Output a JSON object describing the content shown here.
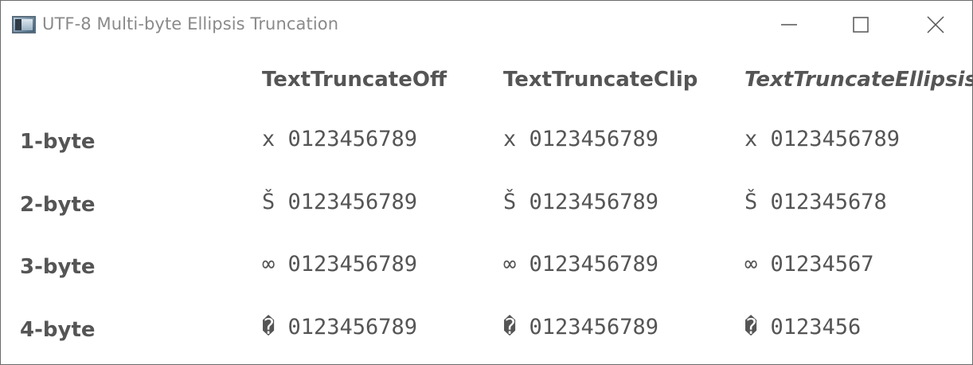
{
  "window": {
    "title": "UTF-8 Multi-byte Ellipsis Truncation",
    "controls": {
      "minimize_icon": "minimize-icon",
      "maximize_icon": "maximize-icon",
      "close_icon": "close-icon"
    }
  },
  "table": {
    "columns": [
      "TextTruncateOff",
      "TextTruncateClip",
      "TextTruncateEllipsis"
    ],
    "rows": [
      {
        "label": "1-byte",
        "cells": [
          "x 0123456789",
          "x 0123456789",
          "x 0123456789"
        ]
      },
      {
        "label": "2-byte",
        "cells": [
          "Š 0123456789",
          "Š 0123456789",
          "Š 012345678"
        ]
      },
      {
        "label": "3-byte",
        "cells": [
          "∞ 0123456789",
          "∞ 0123456789",
          "∞ 01234567"
        ]
      },
      {
        "label": "4-byte",
        "cells": [
          "� 0123456789",
          "� 0123456789",
          "� 0123456"
        ]
      }
    ]
  },
  "colors": {
    "text": "#555555",
    "title_text": "#8a8a8a",
    "border": "#6b6b6b",
    "background": "#ffffff"
  }
}
